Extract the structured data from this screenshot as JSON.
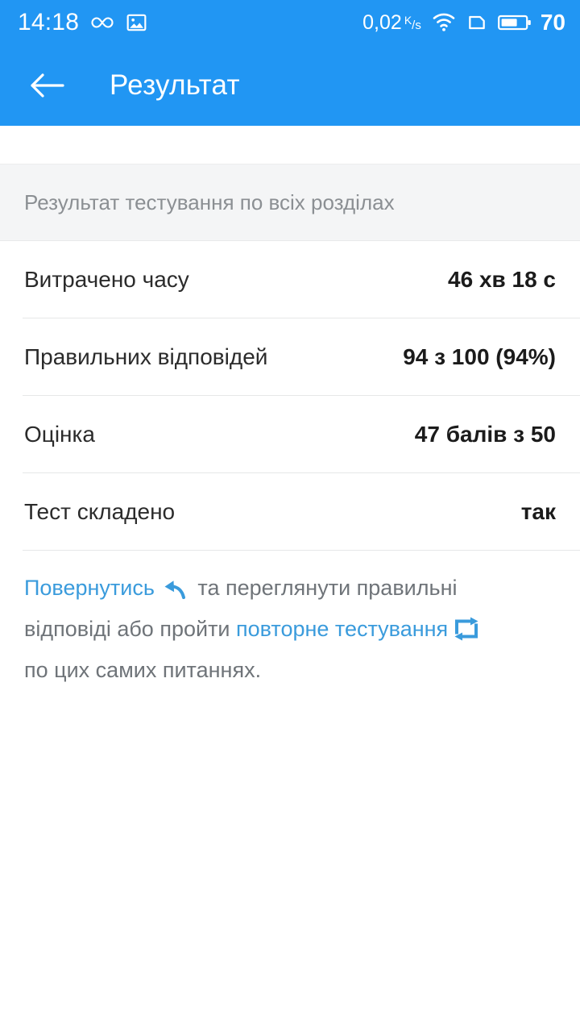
{
  "status_bar": {
    "clock": "14:18",
    "infinity_icon": "infinity-icon",
    "image_icon": "image-icon",
    "net_speed_value": "0,02",
    "net_speed_unit_num": "K",
    "net_speed_unit_den": "s",
    "wifi_icon": "wifi-icon",
    "sim_icon": "sim-card-icon",
    "battery_icon": "battery-icon",
    "battery_level": "70"
  },
  "app_bar": {
    "back_icon": "back-arrow-icon",
    "title": "Результат"
  },
  "section": {
    "subtitle": "Результат тестування по всіх розділах"
  },
  "results": [
    {
      "label": "Витрачено часу",
      "value": "46 хв 18 с"
    },
    {
      "label": "Правильних відповідей",
      "value": "94 з 100 (94%)"
    },
    {
      "label": "Оцінка",
      "value": "47 балів з 50"
    },
    {
      "label": "Тест складено",
      "value": "так"
    }
  ],
  "footer": {
    "link_back": "Повернутись",
    "undo_icon": "undo-arrow-icon",
    "text_1": " та переглянути правильні відповіді або пройти ",
    "link_retest": "повторне тестування",
    "repeat_icon": "repeat-icon",
    "text_2": " по цих самих питаннях."
  },
  "colors": {
    "accent": "#2196f3",
    "link": "#3a9bdc",
    "band": "#f4f5f6",
    "divider": "#e6e7e8",
    "label": "#2b2b2b",
    "muted": "#8b8f93"
  }
}
